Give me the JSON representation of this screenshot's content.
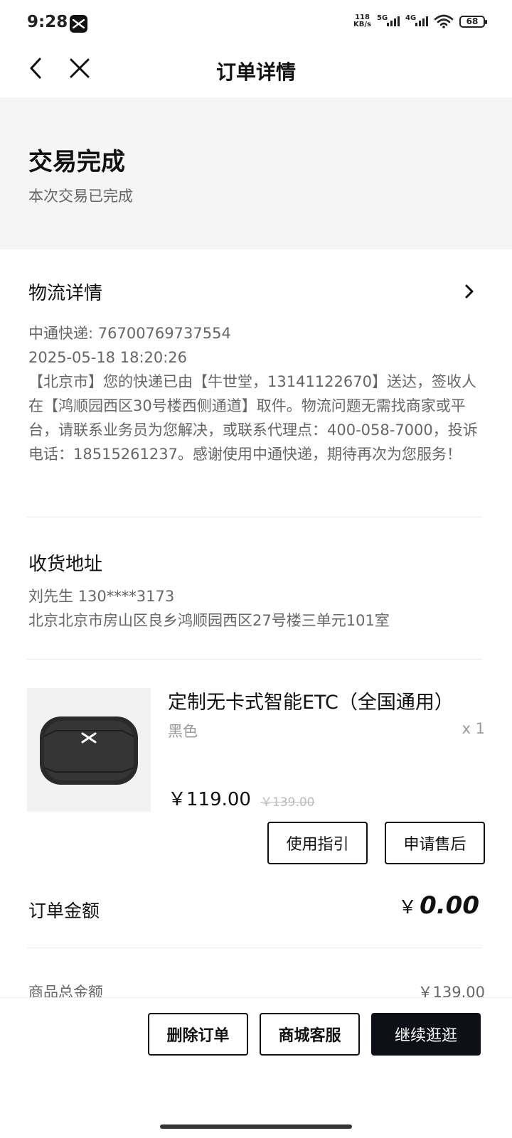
{
  "status_bar": {
    "time": "9:28",
    "net_speed_value": "118",
    "net_speed_unit": "KB/s",
    "sig1": "5G",
    "sig2": "4G",
    "battery": "68"
  },
  "nav": {
    "title": "订单详情",
    "back_icon": "chevron-left-icon",
    "close_icon": "close-icon"
  },
  "status": {
    "title": "交易完成",
    "subtitle": "本次交易已完成"
  },
  "logistics": {
    "title": "物流详情",
    "carrier_line": "中通快递: 76700769737554",
    "time": "2025-05-18 18:20:26",
    "message": "【北京市】您的快递已由【牛世堂，13141122670】送达，签收人在【鸿顺园西区30号楼西侧通道】取件。物流问题无需找商家或平台，请联系业务员为您解决，或联系代理点：400-058-7000，投诉电话：18515261237。感谢使用中通快递，期待再次为您服务！"
  },
  "address": {
    "title": "收货地址",
    "name_phone": "刘先生  130****3173",
    "detail": "北京北京市房山区良乡鸿顺园西区27号楼三单元101室"
  },
  "product": {
    "name": "定制无卡式智能ETC（全国通用）",
    "variant": "黑色",
    "qty": "x 1",
    "price": "￥119.00",
    "original_price": "￥139.00",
    "btn_guide": "使用指引",
    "btn_after_sale": "申请售后"
  },
  "order": {
    "label": "订单金额",
    "currency": "￥",
    "amount": "0.00",
    "goods_total_label": "商品总金额",
    "goods_total_value": "￥139.00"
  },
  "actions": {
    "delete": "删除订单",
    "service": "商城客服",
    "continue": "继续逛逛"
  }
}
